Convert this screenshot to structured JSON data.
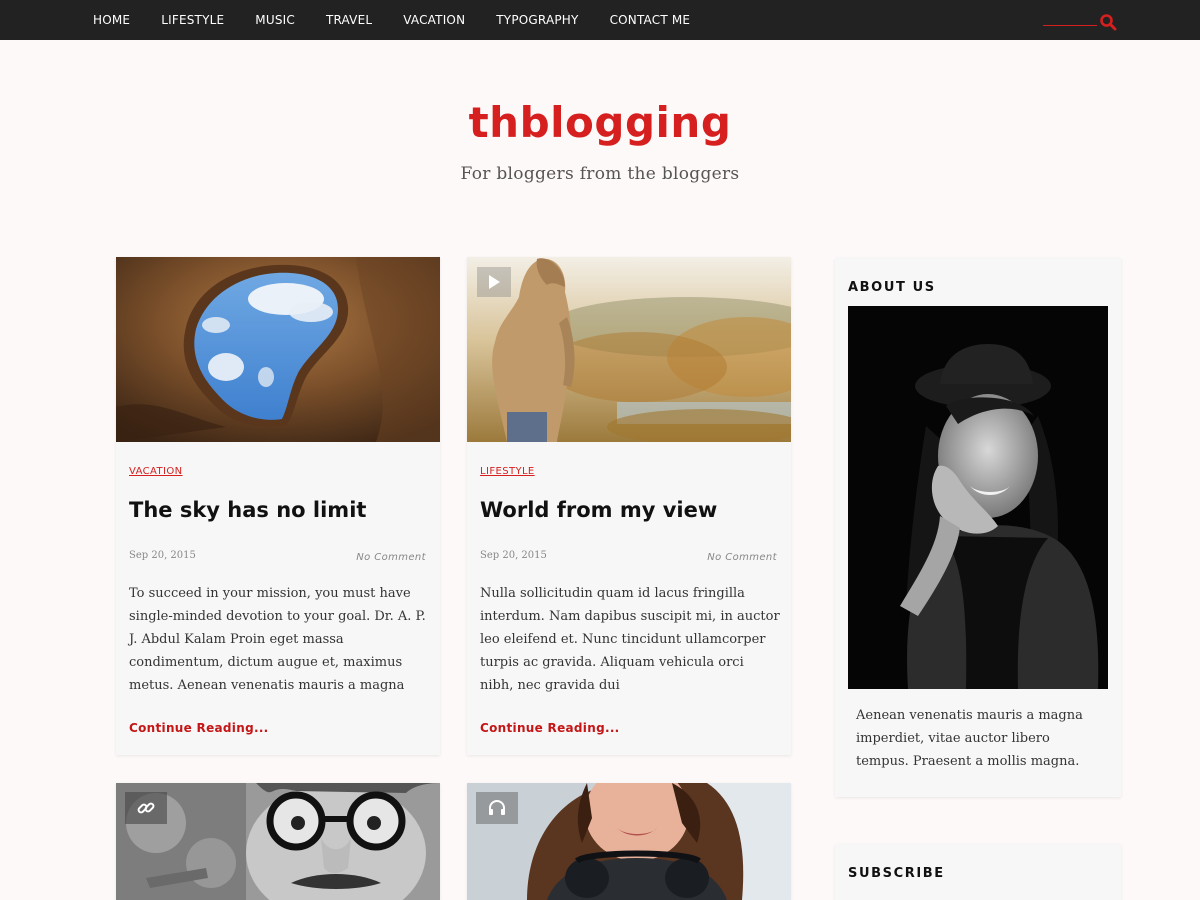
{
  "nav": {
    "items": [
      "HOME",
      "LIFESTYLE",
      "MUSIC",
      "TRAVEL",
      "VACATION",
      "TYPOGRAPHY",
      "CONTACT ME"
    ]
  },
  "search": {
    "icon": "search-icon"
  },
  "header": {
    "title": "thblogging",
    "tagline": "For bloggers from the bloggers"
  },
  "colors": {
    "accent": "#d61f1f",
    "topbar": "#222222",
    "background": "#fdf9f8",
    "card": "#f7f7f7"
  },
  "posts": [
    {
      "category": "VACATION",
      "title": "The sky has no limit",
      "date": "Sep 20, 2015",
      "comments": "No Comment",
      "excerpt": "To succeed in your mission, you must have single-minded devotion to your goal. Dr. A. P. J. Abdul Kalam Proin eget massa condimentum, dictum augue et, maximus metus. Aenean venenatis mauris a magna",
      "more": "Continue Reading...",
      "image": "cave-sky-photo"
    },
    {
      "category": "LIFESTYLE",
      "title": "World from my view",
      "date": "Sep 20, 2015",
      "comments": "No Comment",
      "excerpt": "Nulla sollicitudin quam id lacus fringilla interdum. Nam dapibus suscipit mi, in auctor leo eleifend et. Nunc tincidunt ullamcorper turpis ac gravida. Aliquam vehicula orci nibh, nec gravida dui",
      "more": "Continue Reading...",
      "image": "hooded-man-autumn-photo",
      "format_icon": "play-icon"
    },
    {
      "image": "man-with-glasses-photo",
      "format_icon": "link-icon"
    },
    {
      "image": "woman-headphones-photo",
      "format_icon": "headphones-icon"
    }
  ],
  "sidebar": {
    "about": {
      "title": "ABOUT US",
      "image": "woman-hat-portrait",
      "text": "Aenean venenatis mauris a magna imperdiet, vitae auctor libero tempus. Praesent a mollis magna."
    },
    "subscribe": {
      "title": "SUBSCRIBE"
    }
  }
}
